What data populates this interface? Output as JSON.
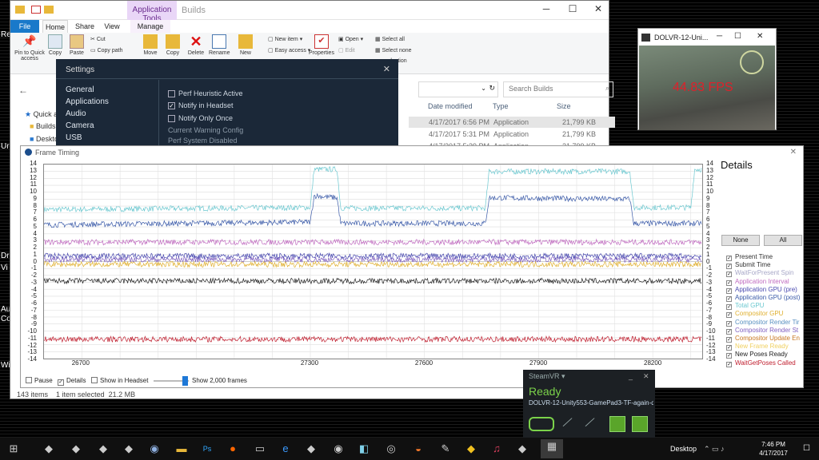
{
  "explorer": {
    "ribbon_context_tab": "Application Tools",
    "title": "Builds",
    "tabs": [
      "File",
      "Home",
      "Share",
      "View",
      "Manage"
    ],
    "ribbon": {
      "pin": "Pin to Quick access",
      "copy": "Copy",
      "paste": "Paste",
      "cut": "Cut",
      "copy_path": "Copy path",
      "move": "Move",
      "copy_to": "Copy",
      "delete": "Delete",
      "rename": "Rename",
      "new": "New",
      "new_item": "New item",
      "easy_access": "Easy access",
      "properties": "Properties",
      "open": "Open",
      "edit": "Edit",
      "select_all": "Select all",
      "select_none": "Select none",
      "invert_selection": "selection"
    },
    "search_placeholder": "Search Builds",
    "nav": {
      "quick": "Quick ac",
      "builds": "Builds",
      "desktop": "Deskto"
    },
    "columns": {
      "date": "Date modified",
      "type": "Type",
      "size": "Size"
    },
    "rows": [
      {
        "date": "4/17/2017 6:56 PM",
        "type": "Application",
        "size": "21,799 KB"
      },
      {
        "date": "4/17/2017 5:31 PM",
        "type": "Application",
        "size": "21,799 KB"
      },
      {
        "date": "4/17/2017 5:39 PM",
        "type": "Application",
        "size": "21,799 KB"
      }
    ],
    "status": {
      "items": "143 items",
      "selected": "1 item selected",
      "size": "21.2 MB"
    }
  },
  "settings": {
    "title": "Settings",
    "nav": [
      "General",
      "Applications",
      "Audio",
      "Camera",
      "USB"
    ],
    "options": [
      {
        "label": "Perf Heuristic Active",
        "checked": false
      },
      {
        "label": "Notify in Headset",
        "checked": true
      },
      {
        "label": "Notify Only Once",
        "checked": false
      }
    ],
    "info1": "Current Warning Config",
    "info2": "Perf System Disabled"
  },
  "game": {
    "title": "DOLVR-12-Uni...",
    "fps": "44.83 FPS"
  },
  "frame_timing": {
    "title": "Frame Timing",
    "details_title": "Details",
    "none_label": "None",
    "all_label": "All",
    "legend": [
      {
        "name": "Present Time",
        "color": "#333333"
      },
      {
        "name": "Submit Time",
        "color": "#333333"
      },
      {
        "name": "WaitForPresent Spin",
        "color": "#a8a8c8"
      },
      {
        "name": "Application Interval",
        "color": "#c06cc0"
      },
      {
        "name": "Application GPU (pre)",
        "color": "#4a4ab0"
      },
      {
        "name": "Application GPU (post)",
        "color": "#3a5aa8"
      },
      {
        "name": "Total GPU",
        "color": "#6cc8d0"
      },
      {
        "name": "Compositor GPU",
        "color": "#e0b030"
      },
      {
        "name": "Compositor Render Tir",
        "color": "#5890c0"
      },
      {
        "name": "Compositor Render St",
        "color": "#8060c0"
      },
      {
        "name": "Compositor Update En",
        "color": "#c87820"
      },
      {
        "name": "New Frame Ready",
        "color": "#f0d060"
      },
      {
        "name": "New Poses Ready",
        "color": "#222222"
      },
      {
        "name": "WaitGetPoses Called",
        "color": "#c02030"
      }
    ],
    "pause_label": "Pause",
    "details_label": "Details",
    "headset_label": "Show in Headset",
    "frames_label": "Show 2,000 frames"
  },
  "chart_data": {
    "type": "line",
    "ylim": [
      -14,
      14
    ],
    "xlim": [
      26600,
      28330
    ],
    "y_ticks": [
      14,
      13,
      12,
      11,
      10,
      9,
      8,
      7,
      6,
      5,
      4,
      3,
      2,
      1,
      0,
      -1,
      -2,
      -3,
      -4,
      -5,
      -6,
      -7,
      -8,
      -9,
      -10,
      -11,
      -12,
      -13,
      -14
    ],
    "x_ticks": [
      26700,
      26800,
      26900,
      27000,
      27100,
      27200,
      27300,
      27400,
      27500,
      27600,
      27700,
      27800,
      27900,
      28000,
      28100,
      28200,
      28300
    ],
    "x_tick_labels": [
      "26700",
      "27300",
      "27600",
      "27900",
      "28200"
    ],
    "series": [
      {
        "color": "#6cc8d0",
        "segments": [
          [
            26600,
            7.5
          ],
          [
            27300,
            7.8
          ],
          [
            27310,
            13.3
          ],
          [
            27370,
            13.3
          ],
          [
            27380,
            7.7
          ],
          [
            27760,
            7.7
          ],
          [
            27770,
            13.0
          ],
          [
            28140,
            13.0
          ],
          [
            28150,
            7.8
          ],
          [
            28300,
            7.8
          ],
          [
            28310,
            13.3
          ],
          [
            28330,
            13.3
          ]
        ]
      },
      {
        "color": "#3a5aa8",
        "segments": [
          [
            26600,
            5.3
          ],
          [
            27300,
            5.7
          ],
          [
            27310,
            9.5
          ],
          [
            27370,
            9.2
          ],
          [
            27380,
            5.5
          ],
          [
            27760,
            5.5
          ],
          [
            27770,
            9.2
          ],
          [
            28140,
            9.0
          ],
          [
            28150,
            5.5
          ],
          [
            28330,
            5.5
          ]
        ]
      },
      {
        "color": "#c06cc0",
        "segments": [
          [
            26600,
            2.8
          ],
          [
            28330,
            2.8
          ]
        ]
      },
      {
        "color": "#8060c0",
        "segments": [
          [
            26600,
            0.3
          ],
          [
            28330,
            0.3
          ]
        ]
      },
      {
        "color": "#4a4ab0",
        "segments": [
          [
            26600,
            0.8
          ],
          [
            28330,
            0.8
          ]
        ]
      },
      {
        "color": "#e0b030",
        "segments": [
          [
            26600,
            -0.4
          ],
          [
            28330,
            -0.4
          ]
        ]
      },
      {
        "color": "#222222",
        "segments": [
          [
            26600,
            -2.8
          ],
          [
            28330,
            -2.8
          ]
        ]
      },
      {
        "color": "#c02030",
        "segments": [
          [
            26600,
            -11.2
          ],
          [
            27300,
            -11.2
          ],
          [
            27340,
            -11.2
          ],
          [
            27720,
            -11.2
          ],
          [
            27780,
            -11.2
          ],
          [
            28330,
            -11.2
          ]
        ]
      }
    ]
  },
  "steamvr": {
    "header": "SteamVR",
    "status": "Ready",
    "app": "DOLVR-12-Unity553-GamePad3-TF-again-qu"
  },
  "taskbar": {
    "desktop_label": "Desktop",
    "time": "7:46 PM",
    "date": "4/17/2017"
  },
  "desktop_labels": [
    "Re",
    "Ur",
    "Dr",
    "Vi",
    "Au",
    "Co",
    "Wi"
  ]
}
